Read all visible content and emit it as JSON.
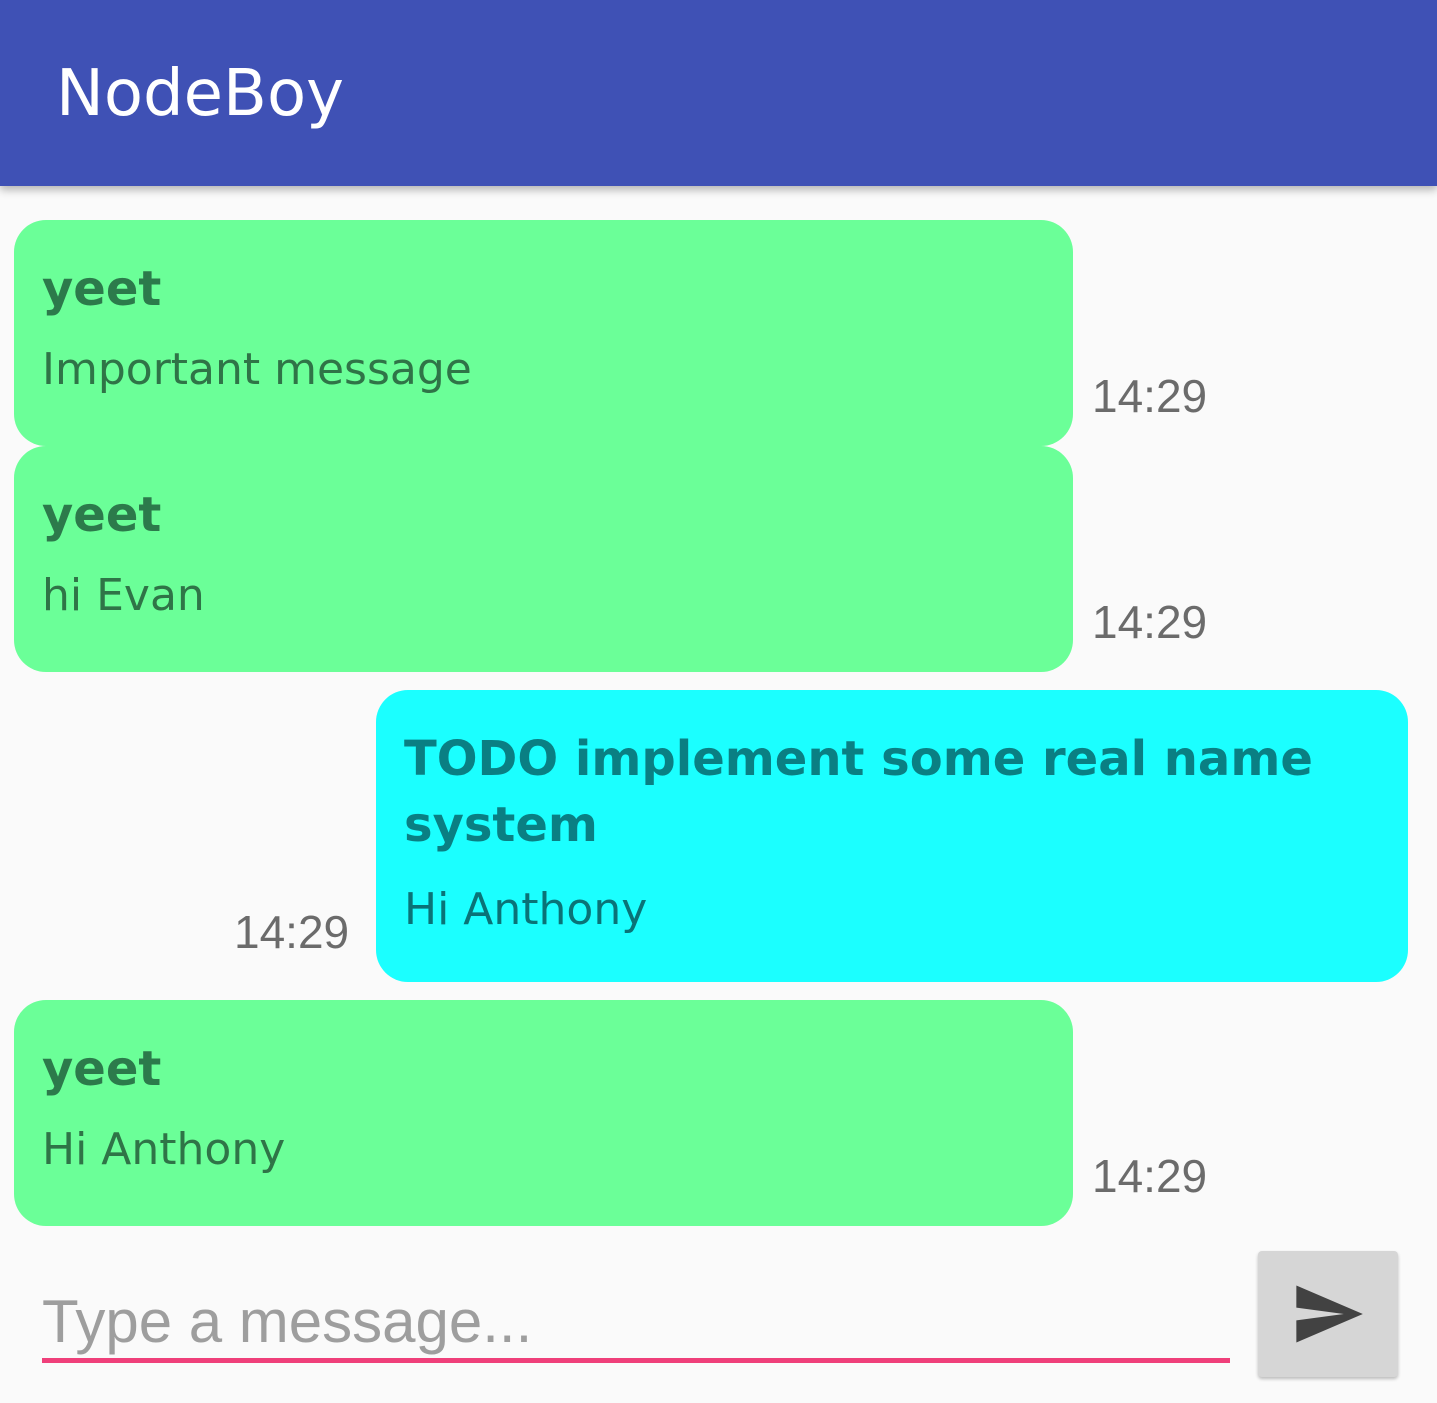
{
  "app": {
    "title": "NodeBoy"
  },
  "colors": {
    "appbar": "#3f51b5",
    "other_bubble": "#6bff98",
    "mine_bubble": "#1bffff",
    "input_underline": "#ef3f7a",
    "send_button": "#d6d6d6"
  },
  "messages": [
    {
      "side": "other",
      "sender": "yeet",
      "text": "Important message",
      "time": "14:29"
    },
    {
      "side": "other",
      "sender": "yeet",
      "text": "hi Evan",
      "time": "14:29"
    },
    {
      "side": "mine",
      "sender": "TODO implement some real name system",
      "text": "Hi Anthony",
      "time": "14:29"
    },
    {
      "side": "other",
      "sender": "yeet",
      "text": "Hi Anthony",
      "time": "14:29"
    }
  ],
  "composer": {
    "placeholder": "Type a message...",
    "value": "",
    "send_icon": "send-icon"
  }
}
